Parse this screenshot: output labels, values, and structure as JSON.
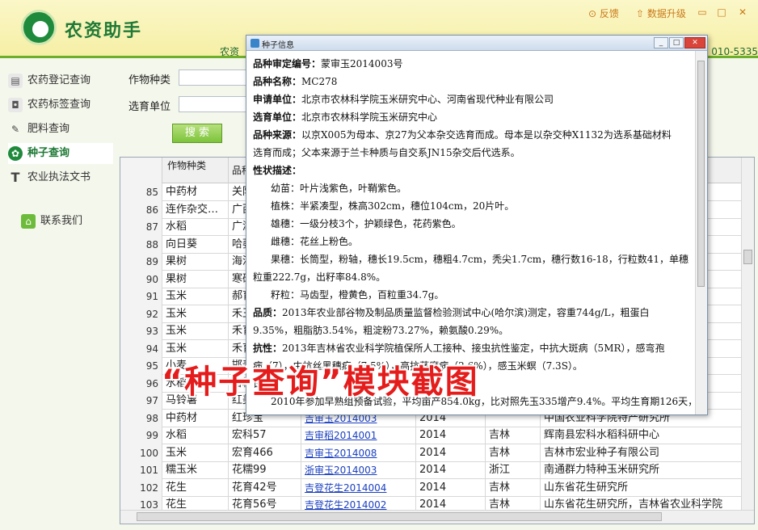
{
  "app": {
    "title": "农资助手",
    "feedback": "反馈",
    "upgrade": "数据升级",
    "subbar_left": "农资",
    "subbar_right": "：010-5335"
  },
  "sidebar": {
    "items": [
      {
        "label": "农药登记查询",
        "icon": "bar-chart-icon"
      },
      {
        "label": "农药标签查询",
        "icon": "label-icon"
      },
      {
        "label": "肥料查询",
        "icon": "fertilizer-icon"
      },
      {
        "label": "种子查询",
        "icon": "seed-icon"
      },
      {
        "label": "农业执法文书",
        "icon": "document-T-icon"
      }
    ],
    "contact": "联系我们"
  },
  "search": {
    "crop_label": "作物种类",
    "breeder_label": "选育单位",
    "button": "搜 索"
  },
  "table": {
    "headers": [
      "作物种类",
      "品种",
      "",
      "",
      "",
      ""
    ],
    "rows": [
      {
        "n": "85",
        "crop": "中药材",
        "variety": "关防",
        "code": "",
        "year": "",
        "prov": "",
        "org": "大学"
      },
      {
        "n": "86",
        "crop": "连作杂交…",
        "variety": "广西",
        "code": "",
        "year": "",
        "prov": "",
        "org": ""
      },
      {
        "n": "87",
        "crop": "水稻",
        "variety": "广湖",
        "code": "",
        "year": "",
        "prov": "",
        "org": ""
      },
      {
        "n": "88",
        "crop": "向日葵",
        "variety": "哈萎",
        "code": "",
        "year": "",
        "prov": "",
        "org": ""
      },
      {
        "n": "89",
        "crop": "果树",
        "variety": "海河",
        "code": "",
        "year": "",
        "prov": "",
        "org": ""
      },
      {
        "n": "90",
        "crop": "果树",
        "variety": "寒研",
        "code": "",
        "year": "",
        "prov": "",
        "org": ""
      },
      {
        "n": "91",
        "crop": "玉米",
        "variety": "郝育",
        "code": "",
        "year": "",
        "prov": "",
        "org": ""
      },
      {
        "n": "92",
        "crop": "玉米",
        "variety": "禾玉",
        "code": "",
        "year": "",
        "prov": "",
        "org": ""
      },
      {
        "n": "93",
        "crop": "玉米",
        "variety": "禾育",
        "code": "",
        "year": "",
        "prov": "",
        "org": ""
      },
      {
        "n": "94",
        "crop": "玉米",
        "variety": "禾育",
        "code": "",
        "year": "",
        "prov": "",
        "org": ""
      },
      {
        "n": "95",
        "crop": "小麦",
        "variety": "邯麦",
        "code": "",
        "year": "",
        "prov": "",
        "org": ""
      },
      {
        "n": "96",
        "crop": "水稻",
        "variety": "吉粳",
        "code": "",
        "year": "",
        "prov": "",
        "org": ""
      },
      {
        "n": "97",
        "crop": "马铃薯",
        "variety": "红美",
        "code": "",
        "year": "",
        "prov": "",
        "org": "物技术有"
      },
      {
        "n": "98",
        "crop": "中药材",
        "variety": "红珍宝",
        "code": "吉审玉2014003",
        "year": "2014",
        "prov": "",
        "org": "中国农业科学院特产研究所"
      },
      {
        "n": "99",
        "crop": "水稻",
        "variety": "宏科57",
        "code": "吉审稻2014001",
        "year": "2014",
        "prov": "吉林",
        "org": "辉南县宏科水稻科研中心"
      },
      {
        "n": "100",
        "crop": "玉米",
        "variety": "宏育466",
        "code": "吉审玉2014008",
        "year": "2014",
        "prov": "吉林",
        "org": "吉林市宏业种子有限公司"
      },
      {
        "n": "101",
        "crop": "糯玉米",
        "variety": "花糯99",
        "code": "浙审玉2014003",
        "year": "2014",
        "prov": "浙江",
        "org": "南通群力特种玉米研究所"
      },
      {
        "n": "102",
        "crop": "花生",
        "variety": "花育42号",
        "code": "吉登花生2014004",
        "year": "2014",
        "prov": "吉林",
        "org": "山东省花生研究所"
      },
      {
        "n": "103",
        "crop": "花生",
        "variety": "花育56号",
        "code": "吉登花生2014002",
        "year": "2014",
        "prov": "吉林",
        "org": "山东省花生研究所，吉林省农业科学院"
      }
    ]
  },
  "dialog": {
    "title": "种子信息",
    "lines": [
      {
        "k": "品种审定编号：",
        "v": "蒙审玉2014003号"
      },
      {
        "k": "品种名称：",
        "v": "MC278"
      },
      {
        "k": "申请单位：",
        "v": "北京市农林科学院玉米研究中心、河南省现代种业有限公司"
      },
      {
        "k": "选育单位：",
        "v": "北京市农林科学院玉米研究中心"
      },
      {
        "k": "品种来源：",
        "v": "以京X005为母本、京27为父本杂交选育而成。母本是以杂交种X1132为选系基础材料"
      },
      {
        "k": "",
        "v": "选育而成；父本来源于兰卡种质与自交系JN15杂交后代选系。"
      },
      {
        "k": "性状描述：",
        "v": ""
      },
      {
        "k": "",
        "v": "幼苗：叶片浅紫色，叶鞘紫色。",
        "ind": true
      },
      {
        "k": "",
        "v": "植株：半紧凑型，株高302cm，穗位104cm，20片叶。",
        "ind": true
      },
      {
        "k": "",
        "v": "雄穗：一级分枝3个，护颖绿色，花药紫色。",
        "ind": true
      },
      {
        "k": "",
        "v": "雌穗：花丝上粉色。",
        "ind": true
      },
      {
        "k": "",
        "v": "果穗：长筒型，粉轴，穗长19.5cm，穗粗4.7cm，秃尖1.7cm，穗行数16-18，行粒数41，单穗",
        "ind": true
      },
      {
        "k": "",
        "v": "粒重222.7g，出籽率84.8%。"
      },
      {
        "k": "",
        "v": "籽粒：马齿型，橙黄色，百粒重34.7g。",
        "ind": true
      },
      {
        "k": "品质：",
        "v": "2013年农业部谷物及制品质量监督检验测试中心(哈尔滨)测定，容重744g/L，粗蛋白"
      },
      {
        "k": "",
        "v": "9.35%，粗脂肪3.54%，粗淀粉73.27%，赖氨酸0.29%。"
      },
      {
        "k": "抗性：",
        "v": "2013年吉林省农业科学院植保所人工接种、接虫抗性鉴定，中抗大斑病（5MR），感弯孢"
      },
      {
        "k": "",
        "v": "病（7），中抗丝黑穗病（7.5%），高抗茎腐病（2.6%），感玉米螟（7.3S）。"
      },
      {
        "k": "",
        "v": "试验："
      },
      {
        "k": "",
        "v": "2010年参加早熟组预备试验，平均亩产854.0kg，比对照先玉335增产9.4%。平均生育期126天，",
        "ind": true
      }
    ]
  },
  "overlay": {
    "caption": "“种子查询”模块截图"
  },
  "colors": {
    "brand_green": "#1f7a36",
    "header_yellow": "#f6efa6",
    "link_blue": "#1a3fc0",
    "caption_red": "#e51c1c"
  }
}
